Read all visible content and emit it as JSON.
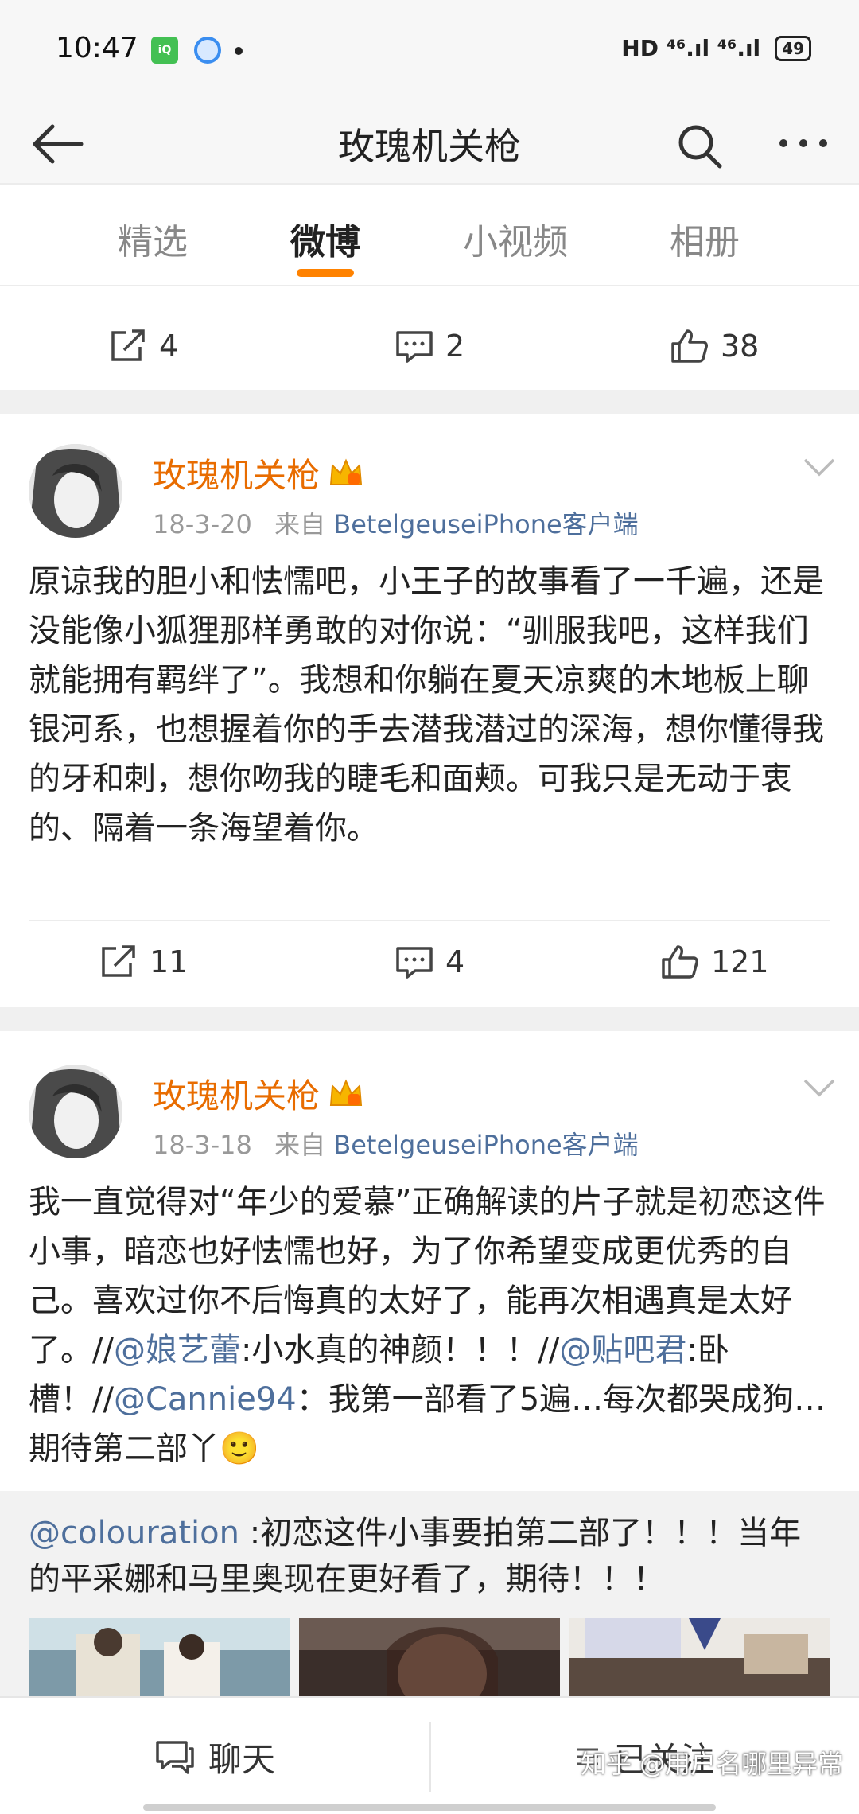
{
  "status_bar": {
    "time": "10:47",
    "app_icon_text": "iQIYI",
    "right_text": "HD ⁴⁶.ıl ⁴⁶.ıl",
    "battery": "49"
  },
  "header": {
    "title": "玫瑰机关枪"
  },
  "tabs": [
    "精选",
    "微博",
    "小视频",
    "相册"
  ],
  "top_action_bar": {
    "repost_count": "4",
    "comment_count": "2",
    "like_count": "38"
  },
  "posts": [
    {
      "author": "玫瑰机关枪",
      "date": "18-3-20",
      "from_label": "来自",
      "source": "BetelgeuseiPhone客户端",
      "text": "原谅我的胆小和怯懦吧，小王子的故事看了一千遍，还是没能像小狐狸那样勇敢的对你说：“驯服我吧，这样我们就能拥有羁绊了”。我想和你躺在夏天凉爽的木地板上聊银河系，也想握着你的手去潜我潜过的深海，想你懂得我的牙和刺，想你吻我的睫毛和面颊。可我只是无动于衷的、隔着一条海望着你。",
      "repost_count": "11",
      "comment_count": "4",
      "like_count": "121"
    },
    {
      "author": "玫瑰机关枪",
      "date": "18-3-18",
      "from_label": "来自",
      "source": "BetelgeuseiPhone客户端",
      "text_parts": [
        "我一直觉得对“年少的爱慕”正确解读的片子就是初恋这件小事，暗恋也好怯懦也好，为了你希望变成更优秀的自己。喜欢过你不后悔真的太好了，能再次相遇真是太好了。//",
        "@娘艺蕾",
        ":小水真的神颜！！！//",
        "@贴吧君",
        ":卧槽！//",
        "@Cannie94",
        "：我第一部看了5遍…每次都哭成狗… 期待第二部丫",
        "🙂"
      ],
      "repost_parts": [
        "@colouration",
        " :初恋这件小事要拍第二部了！！！当年的平采娜和马里奥现在更好看了，期待！！！"
      ]
    }
  ],
  "bottom_bar": {
    "chat_label": "聊天",
    "follow_label": "已关注"
  },
  "watermark": "知乎 @用户名哪里异常",
  "colors": {
    "accent": "#ff8200",
    "author": "#e86c00",
    "link": "#4e6f9c"
  }
}
